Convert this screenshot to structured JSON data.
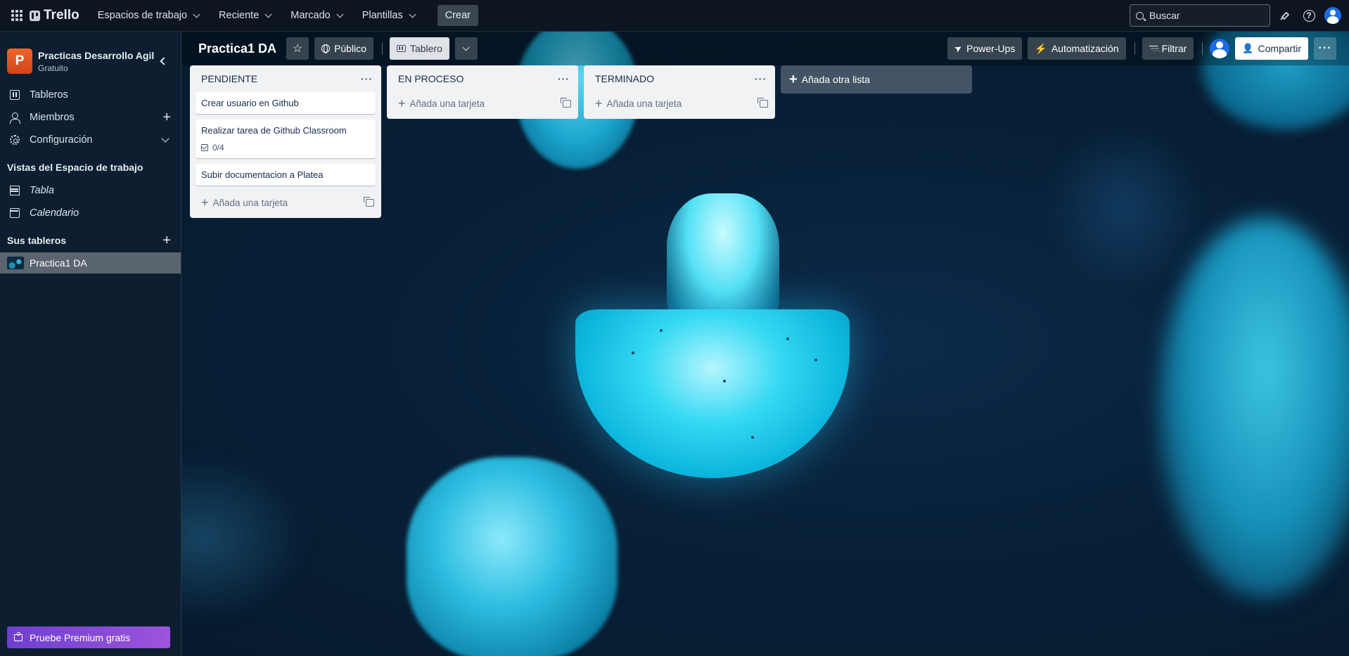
{
  "topbar": {
    "logo": "Trello",
    "nav": [
      {
        "label": "Espacios de trabajo"
      },
      {
        "label": "Reciente"
      },
      {
        "label": "Marcado"
      },
      {
        "label": "Plantillas"
      }
    ],
    "create": "Crear",
    "search_placeholder": "Buscar"
  },
  "sidebar": {
    "workspace_initial": "P",
    "workspace_name": "Practicas Desarrollo Agil",
    "workspace_plan": "Gratuito",
    "items": [
      {
        "label": "Tableros",
        "icon": "board-icon"
      },
      {
        "label": "Miembros",
        "icon": "person-icon"
      },
      {
        "label": "Configuración",
        "icon": "gear-icon"
      }
    ],
    "views_title": "Vistas del Espacio de trabajo",
    "views": [
      {
        "label": "Tabla",
        "icon": "table-icon"
      },
      {
        "label": "Calendario",
        "icon": "calendar-icon"
      }
    ],
    "boards_title": "Sus tableros",
    "boards": [
      {
        "label": "Practica1 DA"
      }
    ],
    "premium": "Pruebe Premium gratis"
  },
  "board": {
    "title": "Practica1 DA",
    "visibility": "Público",
    "view": "Tablero",
    "powerups": "Power-Ups",
    "automation": "Automatización",
    "filter": "Filtrar",
    "share": "Compartir"
  },
  "lists": [
    {
      "title": "PENDIENTE",
      "cards": [
        {
          "title": "Crear usuario en Github"
        },
        {
          "title": "Realizar tarea de Github Classroom",
          "checklist": "0/4"
        },
        {
          "title": "Subir documentacion a Platea"
        }
      ],
      "add_card": "Añada una tarjeta"
    },
    {
      "title": "EN PROCESO",
      "cards": [],
      "add_card": "Añada una tarjeta"
    },
    {
      "title": "TERMINADO",
      "cards": [],
      "add_card": "Añada una tarjeta"
    }
  ],
  "add_list": "Añada otra lista",
  "colors": {
    "topbar": "#0c1520",
    "list_bg": "#f1f2f4",
    "workspace_badge": "#e0561f",
    "premium": "#8a4bd8"
  }
}
